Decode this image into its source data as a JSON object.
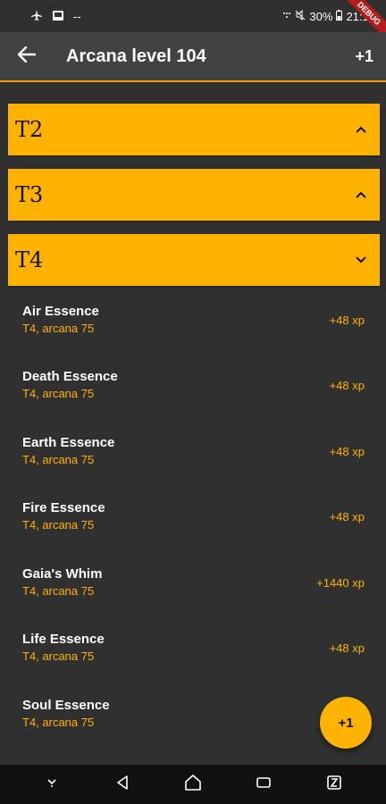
{
  "status_bar": {
    "battery": "30%",
    "time": "21:10",
    "debug_label": "DEBUG",
    "dash": "--"
  },
  "app_bar": {
    "title": "Arcana level 104",
    "action": "+1"
  },
  "tiers": [
    {
      "label": "T2",
      "state": "collapsed"
    },
    {
      "label": "T3",
      "state": "collapsed"
    },
    {
      "label": "T4",
      "state": "expanded"
    }
  ],
  "items": [
    {
      "name": "Air Essence",
      "sub": "T4, arcana 75",
      "xp": "+48 xp"
    },
    {
      "name": "Death Essence",
      "sub": "T4, arcana 75",
      "xp": "+48 xp"
    },
    {
      "name": "Earth Essence",
      "sub": "T4, arcana 75",
      "xp": "+48 xp"
    },
    {
      "name": "Fire Essence",
      "sub": "T4, arcana 75",
      "xp": "+48 xp"
    },
    {
      "name": "Gaia's Whim",
      "sub": "T4, arcana 75",
      "xp": "+1440 xp"
    },
    {
      "name": "Life Essence",
      "sub": "T4, arcana 75",
      "xp": "+48 xp"
    },
    {
      "name": "Soul Essence",
      "sub": "T4, arcana 75",
      "xp": ""
    }
  ],
  "fab": {
    "label": "+1"
  },
  "colors": {
    "accent": "#ffb300",
    "background": "#303030",
    "app_bar": "#424242"
  }
}
